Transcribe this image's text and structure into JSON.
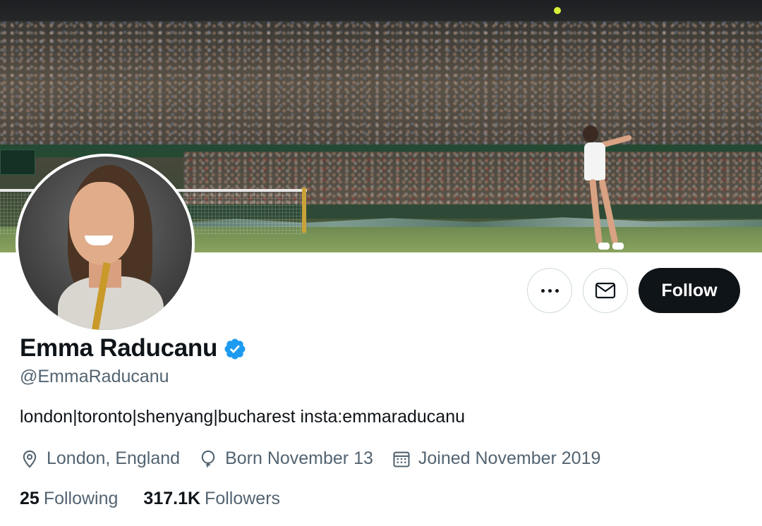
{
  "profile": {
    "display_name": "Emma Raducanu",
    "handle": "@EmmaRaducanu",
    "bio": "london|toronto|shenyang|bucharest insta:emmaraducanu",
    "location": "London, England",
    "birthday": "Born November 13",
    "joined": "Joined November 2019",
    "verified": true
  },
  "stats": {
    "following_count": "25",
    "following_label": "Following",
    "followers_count": "317.1K",
    "followers_label": "Followers"
  },
  "actions": {
    "more_icon": "more-horizontal-icon",
    "message_icon": "envelope-icon",
    "follow_label": "Follow"
  },
  "icons": {
    "verified": "verified-badge-icon",
    "location": "location-pin-icon",
    "birthday": "balloon-icon",
    "joined": "calendar-icon"
  },
  "colors": {
    "primary_text": "#0f1419",
    "secondary_text": "#536471",
    "verified_blue": "#1d9bf0",
    "follow_button_bg": "#0f1419",
    "border": "#cfd9de"
  }
}
